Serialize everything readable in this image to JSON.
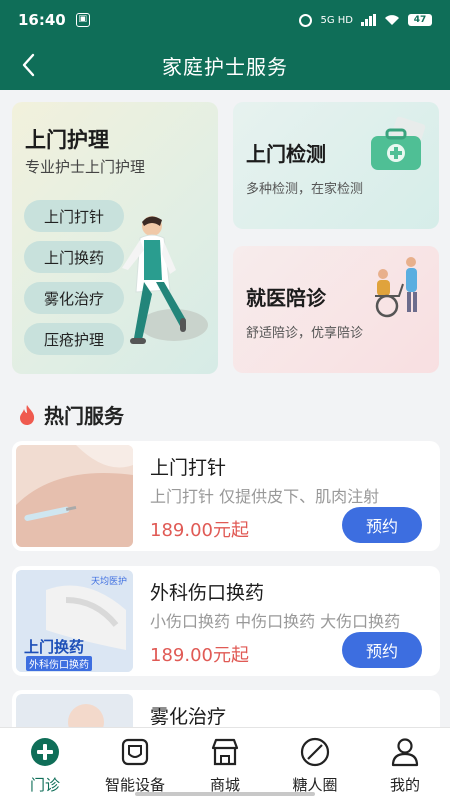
{
  "status_bar": {
    "time": "16:40",
    "network": "5G HD",
    "battery": "47"
  },
  "header": {
    "title": "家庭护士服务"
  },
  "home_care": {
    "title": "上门护理",
    "subtitle": "专业护士上门护理",
    "tags": [
      "上门打针",
      "上门换药",
      "雾化治疗",
      "压疮护理"
    ]
  },
  "home_test": {
    "title": "上门检测",
    "subtitle": "多种检测，在家检测"
  },
  "escort": {
    "title": "就医陪诊",
    "subtitle": "舒适陪诊，优享陪诊"
  },
  "hot": {
    "title": "热门服务",
    "items": [
      {
        "name": "上门打针",
        "desc": "上门打针 仅提供皮下、肌肉注射",
        "price": "189.00元起",
        "button": "预约"
      },
      {
        "name": "外科伤口换药",
        "desc": "小伤口换药 中伤口换药 大伤口换药",
        "price": "189.00元起",
        "button": "预约",
        "thumb_text": {
          "badge": "天均医护",
          "title": "上门换药",
          "sub": "外科伤口换药"
        }
      },
      {
        "name": "雾化治疗"
      }
    ]
  },
  "tabs": [
    {
      "label": "门诊",
      "icon": "plus-circle-icon",
      "active": true
    },
    {
      "label": "智能设备",
      "icon": "device-icon"
    },
    {
      "label": "商城",
      "icon": "store-icon"
    },
    {
      "label": "糖人圈",
      "icon": "circle-slash-icon"
    },
    {
      "label": "我的",
      "icon": "person-icon"
    }
  ],
  "colors": {
    "primary": "#0f6e58",
    "button": "#3d6ee0",
    "price": "#e05a55"
  }
}
